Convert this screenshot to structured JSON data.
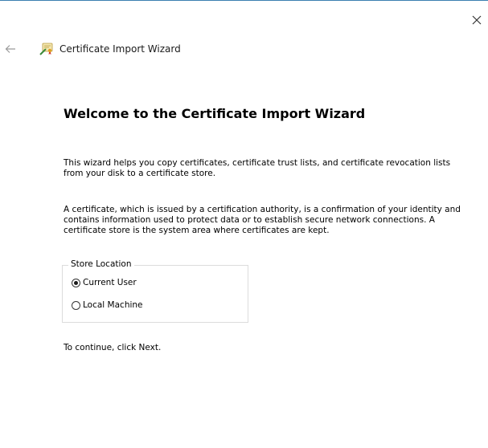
{
  "window": {
    "title": "Certificate Import Wizard",
    "icons": {
      "back": "back-arrow-icon",
      "close": "close-icon",
      "wizard": "certificate-wizard-icon"
    }
  },
  "content": {
    "heading": "Welcome to the Certificate Import Wizard",
    "paragraph1": "This wizard helps you copy certificates, certificate trust lists, and certificate revocation lists from your disk to a certificate store.",
    "paragraph2": "A certificate, which is issued by a certification authority, is a confirmation of your identity and contains information used to protect data or to establish secure network connections. A certificate store is the system area where certificates are kept.",
    "store_location": {
      "legend": "Store Location",
      "options": [
        {
          "label": "Current User",
          "selected": true
        },
        {
          "label": "Local Machine",
          "selected": false
        }
      ]
    },
    "continue_text": "To continue, click Next."
  },
  "colors": {
    "title_bar_border": "#3c7fb1",
    "text": "#000000",
    "group_border": "#dcdcdc"
  }
}
